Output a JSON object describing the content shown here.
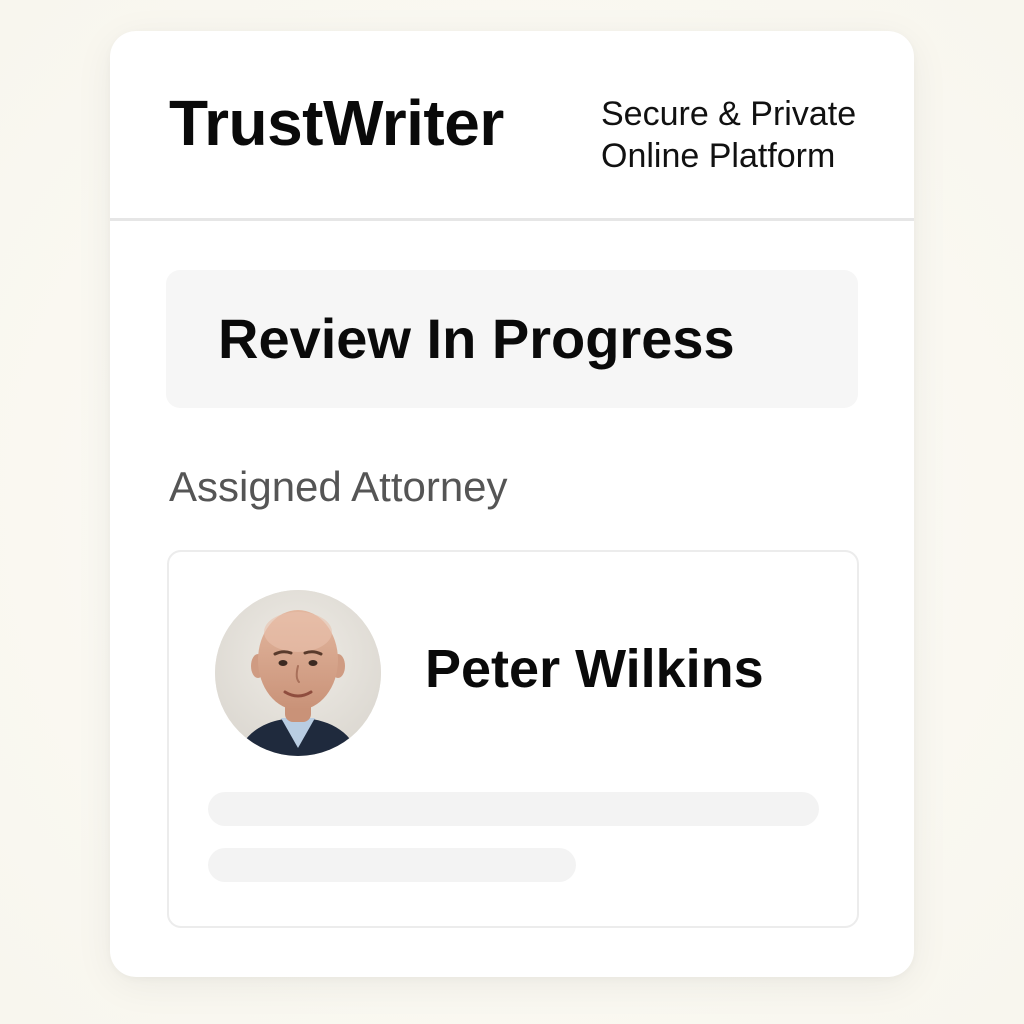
{
  "app": {
    "brand": "TrustWriter",
    "tagline_line1": "Secure & Private",
    "tagline_line2": "Online Platform"
  },
  "status": {
    "label": "Review In Progress"
  },
  "attorney_section": {
    "label": "Assigned Attorney",
    "attorney": {
      "name": "Peter Wilkins",
      "avatar_icon": "person-photo-icon"
    }
  },
  "colors": {
    "background": "#fbfaf4",
    "card": "#ffffff",
    "text_primary": "#0a0a0a",
    "text_secondary": "#555555",
    "status_box": "#f6f6f6",
    "skeleton": "#f3f3f3"
  }
}
